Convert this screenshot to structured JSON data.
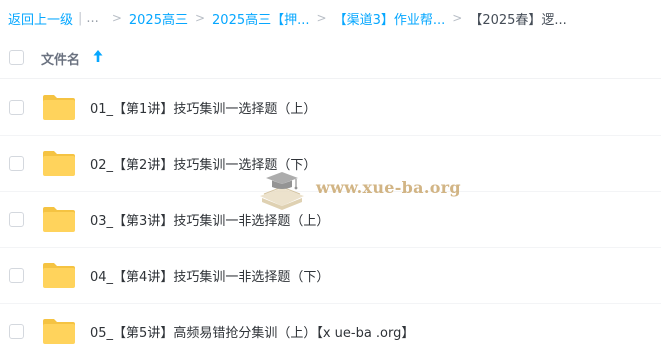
{
  "breadcrumb": {
    "back_label": "返回上一级",
    "separator": "|",
    "ellipsis": "...",
    "chevron": ">",
    "items": [
      {
        "label": "2025高三"
      },
      {
        "label": "2025高三【押..."
      },
      {
        "label": "【渠道3】作业帮..."
      }
    ],
    "current": "【2025春】逻..."
  },
  "list_header": {
    "column_label": "文件名",
    "sort_direction": "ascending"
  },
  "files": [
    {
      "name": "01_【第1讲】技巧集训一选择题（上）",
      "icon": "folder-icon"
    },
    {
      "name": "02_【第2讲】技巧集训一选择题（下）",
      "icon": "folder-icon"
    },
    {
      "name": "03_【第3讲】技巧集训一非选择题（上）",
      "icon": "folder-icon"
    },
    {
      "name": "04_【第4讲】技巧集训一非选择题（下）",
      "icon": "folder-icon"
    },
    {
      "name": "05_【第5讲】高频易错抢分集训（上）【x ue-ba .org】",
      "icon": "folder-icon"
    }
  ],
  "watermark": {
    "text": "www.xue-ba.org"
  },
  "colors": {
    "link": "#06a7ff",
    "folder": "#ffd35c",
    "folder_tab": "#f5c342",
    "watermark": "#c9a56b"
  }
}
